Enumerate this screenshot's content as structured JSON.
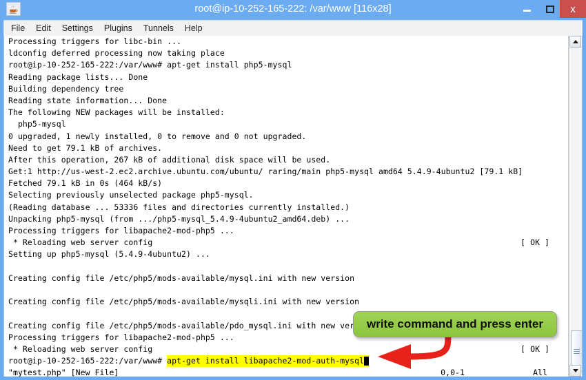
{
  "window": {
    "title": "root@ip-10-252-165-222: /var/www [116x28]",
    "icon": "java-coffee-cup-icon",
    "buttons": {
      "minimize": "minimize-icon",
      "maximize": "maximize-icon",
      "close": "x"
    },
    "colors": {
      "titlebar": "#6aabf2",
      "close_button": "#c9504f",
      "terminal_bg": "#ffffff",
      "terminal_fg": "#000000",
      "highlight": "#ffff00",
      "callout": "#8cc63f",
      "arrow": "#e8221a"
    }
  },
  "menubar": {
    "items": [
      {
        "label": "File"
      },
      {
        "label": "Edit"
      },
      {
        "label": "Settings"
      },
      {
        "label": "Plugins"
      },
      {
        "label": "Tunnels"
      },
      {
        "label": "Help"
      }
    ]
  },
  "terminal": {
    "lines": [
      {
        "text": "Processing triggers for libc-bin ..."
      },
      {
        "text": "ldconfig deferred processing now taking place"
      },
      {
        "text": "root@ip-10-252-165-222:/var/www# apt-get install php5-mysql"
      },
      {
        "text": "Reading package lists... Done"
      },
      {
        "text": "Building dependency tree"
      },
      {
        "text": "Reading state information... Done"
      },
      {
        "text": "The following NEW packages will be installed:"
      },
      {
        "text": "  php5-mysql"
      },
      {
        "text": "0 upgraded, 1 newly installed, 0 to remove and 0 not upgraded."
      },
      {
        "text": "Need to get 79.1 kB of archives."
      },
      {
        "text": "After this operation, 267 kB of additional disk space will be used."
      },
      {
        "text": "Get:1 http://us-west-2.ec2.archive.ubuntu.com/ubuntu/ raring/main php5-mysql amd64 5.4.9-4ubuntu2 [79.1 kB]"
      },
      {
        "text": "Fetched 79.1 kB in 0s (464 kB/s)"
      },
      {
        "text": "Selecting previously unselected package php5-mysql."
      },
      {
        "text": "(Reading database ... 53336 files and directories currently installed.)"
      },
      {
        "text": "Unpacking php5-mysql (from .../php5-mysql_5.4.9-4ubuntu2_amd64.deb) ..."
      },
      {
        "text": "Processing triggers for libapache2-mod-php5 ..."
      },
      {
        "text": " * Reloading web server config",
        "right": "[ OK ]"
      },
      {
        "text": "Setting up php5-mysql (5.4.9-4ubuntu2) ..."
      },
      {
        "text": ""
      },
      {
        "text": "Creating config file /etc/php5/mods-available/mysql.ini with new version"
      },
      {
        "text": ""
      },
      {
        "text": "Creating config file /etc/php5/mods-available/mysqli.ini with new version"
      },
      {
        "text": ""
      },
      {
        "text": "Creating config file /etc/php5/mods-available/pdo_mysql.ini with new version"
      },
      {
        "text": "Processing triggers for libapache2-mod-php5 ..."
      },
      {
        "text": " * Reloading web server config",
        "right": "[ OK ]"
      }
    ],
    "prompt_line": {
      "prompt": "root@ip-10-252-165-222:/var/www# ",
      "command": "apt-get install libapache2-mod-auth-mysql",
      "cursor": "block-cursor"
    },
    "status_line": {
      "text": "\"mytest.php\" [New File]",
      "position": "0,0-1",
      "view": "All"
    }
  },
  "annotation": {
    "callout_text": "write command and press enter",
    "arrow": "red-curved-arrow-icon"
  },
  "scrollbar": {
    "up": "scroll-up-arrow-icon",
    "down": "scroll-down-arrow-icon",
    "thumb": "scrollbar-thumb"
  }
}
